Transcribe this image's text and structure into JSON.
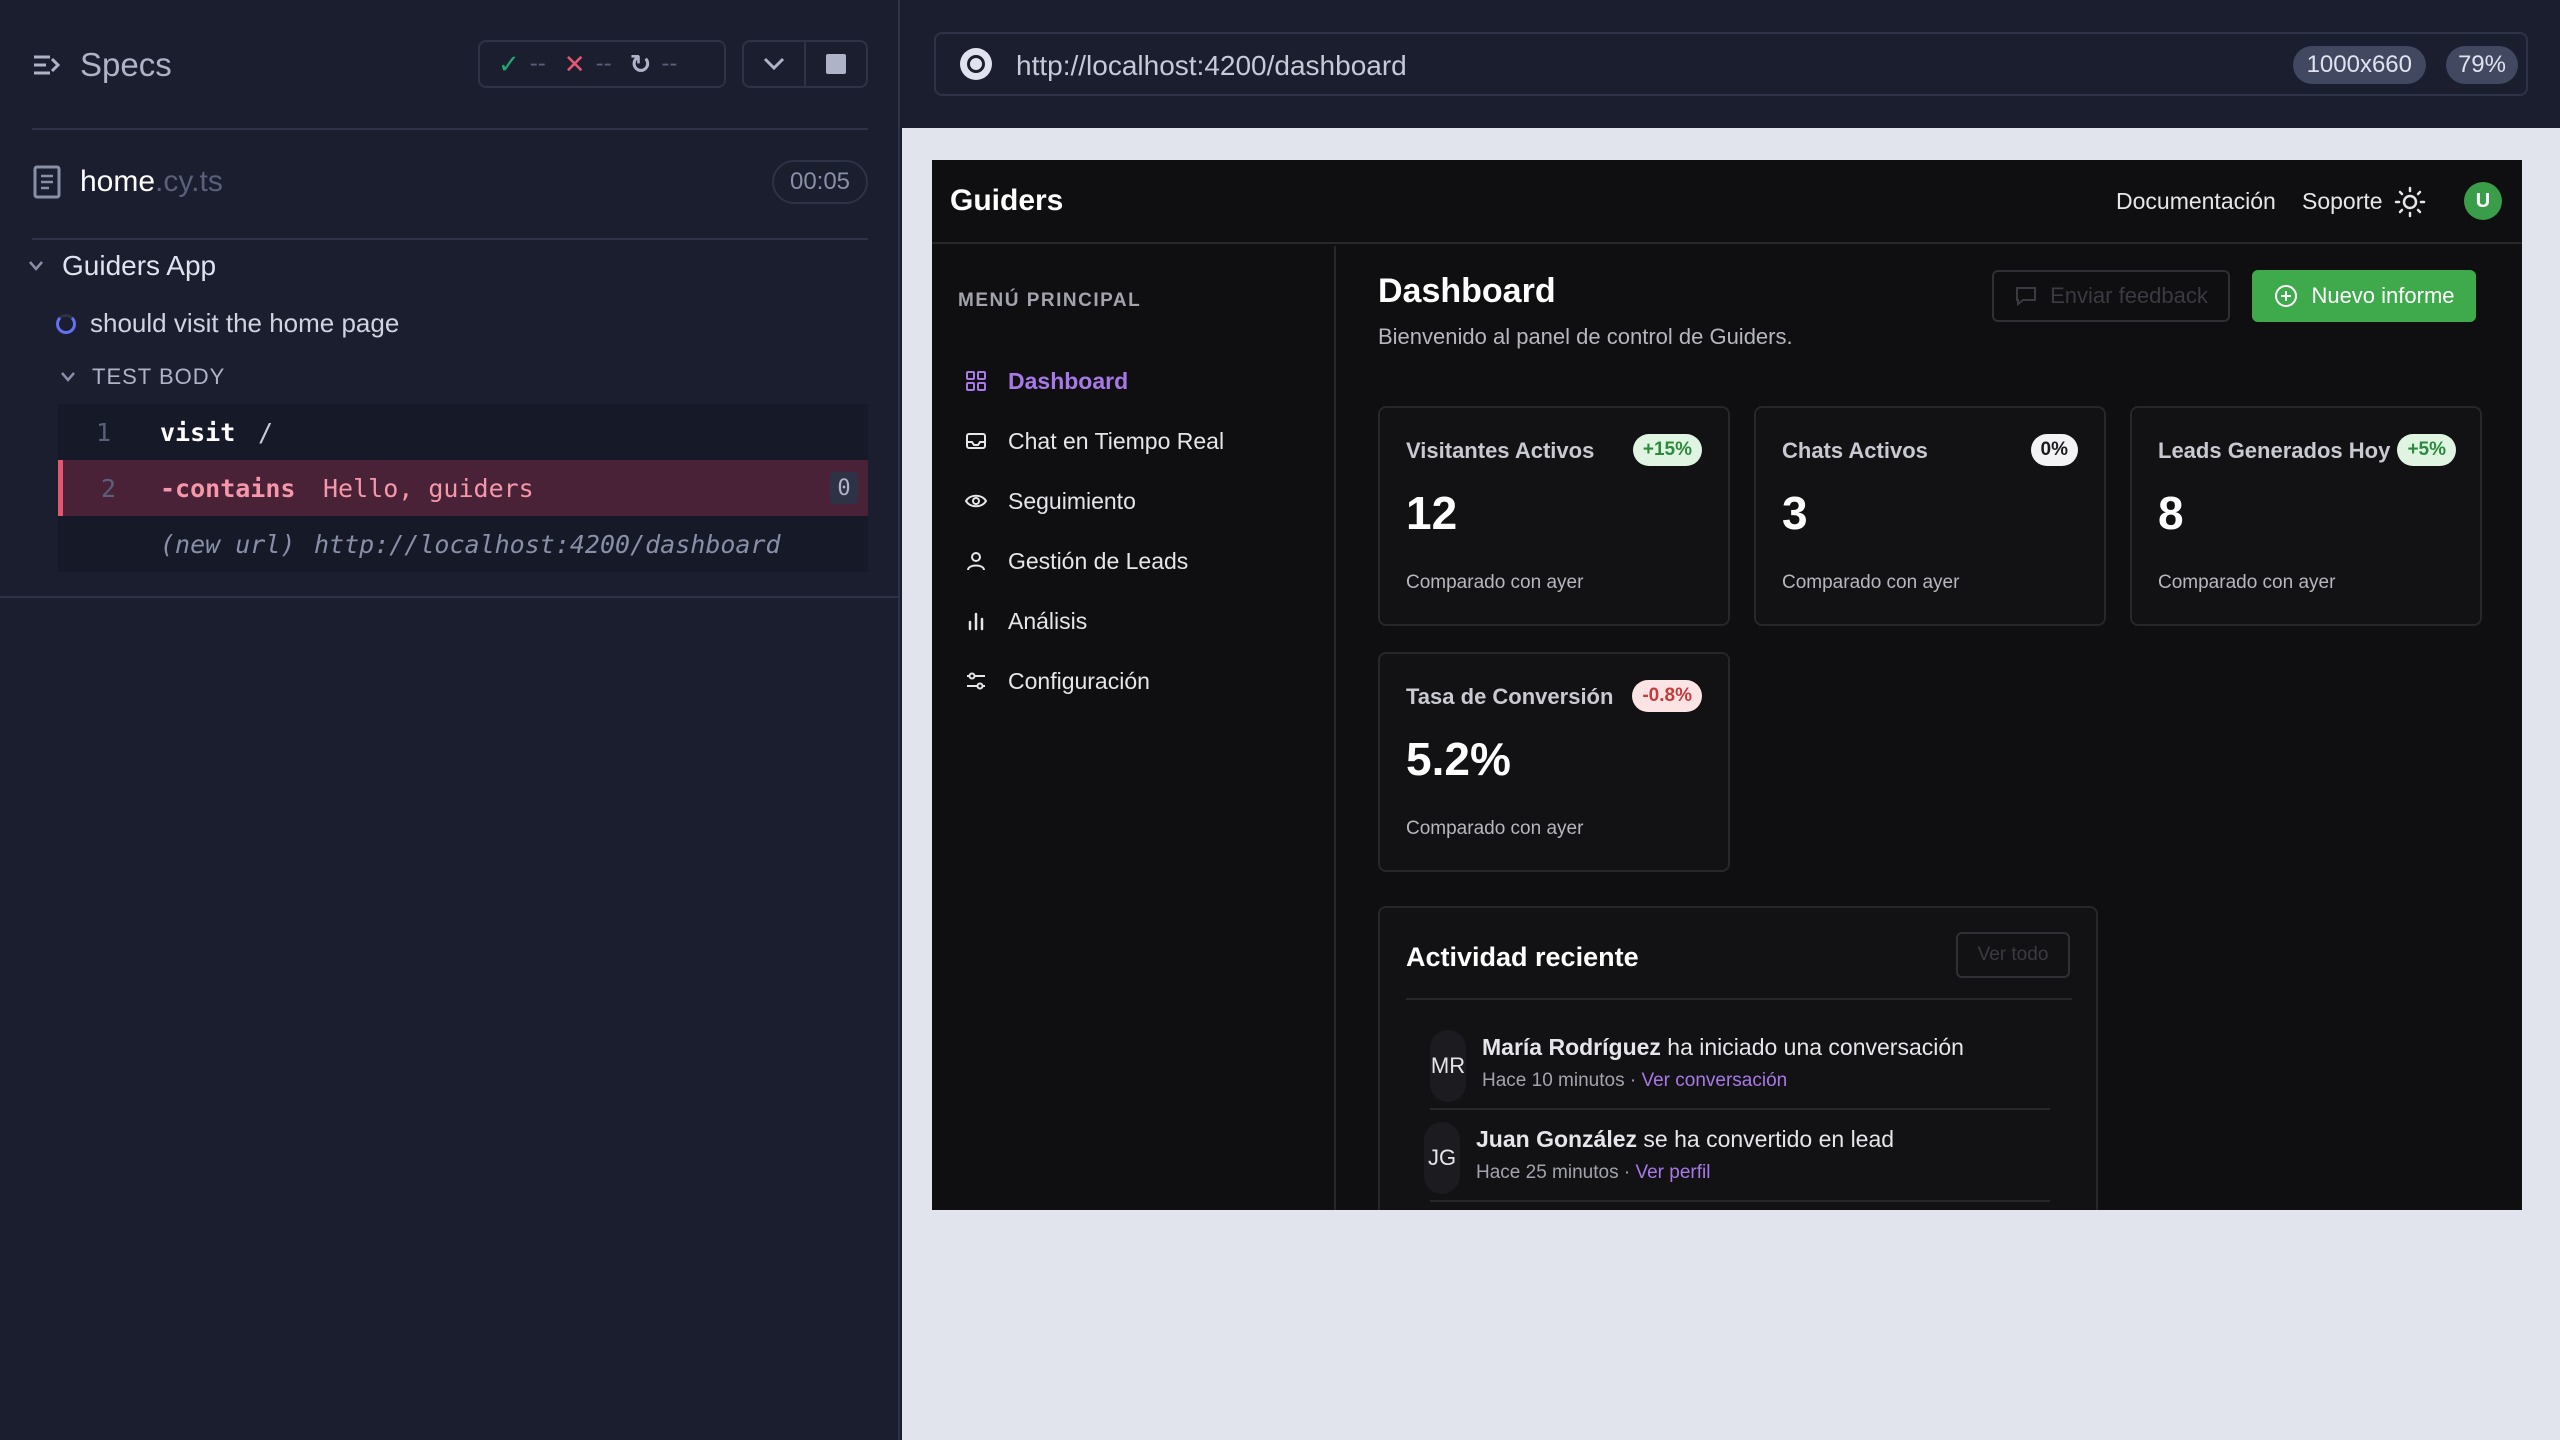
{
  "reporter": {
    "title": "Specs",
    "stats": {
      "passed": "--",
      "failed": "--",
      "pending": "--"
    },
    "colors": {
      "passed": "#1fa971",
      "failed": "#e45770",
      "pending": "#afb3c7"
    },
    "spec": {
      "name": "home",
      "ext": ".cy.ts",
      "duration": "00:05"
    },
    "suite": "Guiders App",
    "test": "should visit the home page",
    "body_label": "TEST BODY",
    "commands": [
      {
        "num": "1",
        "name": "visit",
        "message": "/"
      },
      {
        "num": "2",
        "name": "-contains",
        "message": "Hello, guiders",
        "badge": "0"
      },
      {
        "label": "(new url)",
        "url": "http://localhost:4200/dashboard"
      }
    ]
  },
  "aut": {
    "url": "http://localhost:4200/dashboard",
    "viewport": "1000x660",
    "zoom": "79%"
  },
  "app": {
    "brand": "Guiders",
    "nav": {
      "docs": "Documentación",
      "support": "Soporte"
    },
    "user_initial": "U",
    "menu_heading": "MENÚ PRINCIPAL",
    "menu": [
      {
        "label": "Dashboard",
        "icon": "grid-icon",
        "active": true
      },
      {
        "label": "Chat en Tiempo Real",
        "icon": "inbox-icon"
      },
      {
        "label": "Seguimiento",
        "icon": "eye-icon"
      },
      {
        "label": "Gestión de Leads",
        "icon": "user-icon"
      },
      {
        "label": "Análisis",
        "icon": "bar-chart-icon"
      },
      {
        "label": "Configuración",
        "icon": "sliders-icon"
      }
    ],
    "page": {
      "title": "Dashboard",
      "subtitle": "Bienvenido al panel de control de Guiders.",
      "feedback_label": "Enviar feedback",
      "report_label": "Nuevo informe"
    },
    "cards": [
      {
        "title": "Visitantes Activos",
        "badge": "+15%",
        "value": "12",
        "note": "Comparado con ayer"
      },
      {
        "title": "Chats Activos",
        "badge": "0%",
        "value": "3",
        "note": "Comparado con ayer"
      },
      {
        "title": "Leads Generados Hoy",
        "badge": "+5%",
        "value": "8",
        "note": "Comparado con ayer"
      },
      {
        "title": "Tasa de Conversión",
        "badge": "-0.8%",
        "value": "5.2%",
        "note": "Comparado con ayer"
      }
    ],
    "activity": {
      "title": "Actividad reciente",
      "view_all": "Ver todo",
      "items": [
        {
          "initials": "MR",
          "name": "María Rodríguez",
          "action": " ha iniciado una conversación",
          "time": "Hace 10 minutos · ",
          "link": "Ver conversación"
        },
        {
          "initials": "JG",
          "name": "Juan González",
          "action": " se ha convertido en lead",
          "time": "Hace 25 minutos · ",
          "link": "Ver perfil"
        }
      ]
    },
    "colors": {
      "accent": "#a779e6",
      "primary_button": "#3eaa4c",
      "background": "#0f0f11"
    }
  }
}
